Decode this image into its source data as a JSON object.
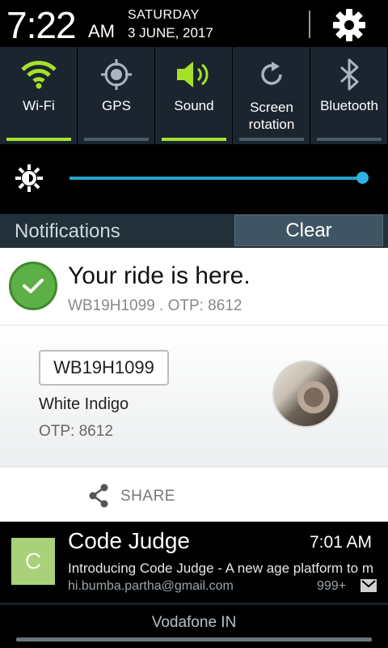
{
  "status_header": {
    "time": "7:22",
    "ampm": "AM",
    "day": "SATURDAY",
    "date": "3 JUNE, 2017",
    "settings_icon": "gear-icon"
  },
  "quick_settings": [
    {
      "label": "Wi-Fi",
      "icon": "wifi-icon",
      "on": true
    },
    {
      "label": "GPS",
      "icon": "gps-icon",
      "on": false
    },
    {
      "label": "Sound",
      "icon": "sound-icon",
      "on": true
    },
    {
      "label": "Screen rotation",
      "label_line1": "Screen",
      "label_line2": "rotation",
      "icon": "rotation-icon",
      "on": false
    },
    {
      "label": "Bluetooth",
      "icon": "bluetooth-icon",
      "on": false
    }
  ],
  "brightness": {
    "icon": "brightness-icon",
    "level": 1.0
  },
  "notifications": {
    "title": "Notifications",
    "clear_label": "Clear"
  },
  "ride": {
    "title": "Your ride is here.",
    "subtitle": "WB19H1099 . OTP: 8612",
    "plate": "WB19H1099",
    "car": "White Indigo",
    "otp": "OTP: 8612",
    "share_label": "SHARE"
  },
  "code_judge": {
    "icon_letter": "C",
    "title": "Code Judge",
    "time": "7:01 AM",
    "text": "Introducing Code Judge - A new age platform to m",
    "email": "hi.bumba.partha@gmail.com",
    "count": "999+"
  },
  "carrier": {
    "label": "Vodafone IN"
  },
  "colors": {
    "accent_green": "#a5e12a",
    "brightness_blue": "#2aa3c9",
    "check_green": "#5cb046",
    "code_judge_icon": "#a9d17a"
  }
}
